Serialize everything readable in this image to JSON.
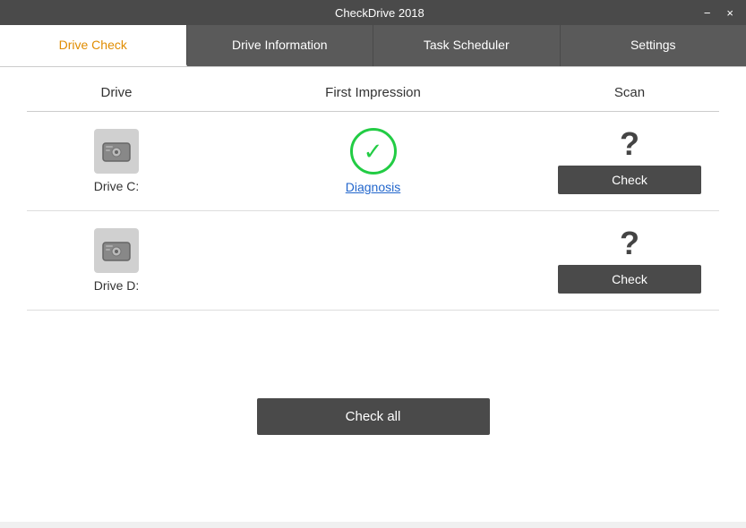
{
  "app": {
    "title": "CheckDrive 2018"
  },
  "titlebar": {
    "minimize_label": "−",
    "close_label": "×"
  },
  "tabs": [
    {
      "id": "drive-check",
      "label": "Drive Check",
      "active": true
    },
    {
      "id": "drive-information",
      "label": "Drive Information",
      "active": false
    },
    {
      "id": "task-scheduler",
      "label": "Task Scheduler",
      "active": false
    },
    {
      "id": "settings",
      "label": "Settings",
      "active": false
    }
  ],
  "table": {
    "col_drive": "Drive",
    "col_impression": "First Impression",
    "col_scan": "Scan"
  },
  "drives": [
    {
      "id": "drive-c",
      "label": "Drive C:",
      "impression_icon": "✓",
      "impression_text": "Diagnosis",
      "scan_symbol": "?",
      "check_label": "Check"
    },
    {
      "id": "drive-d",
      "label": "Drive D:",
      "impression_icon": "",
      "impression_text": "",
      "scan_symbol": "?",
      "check_label": "Check"
    }
  ],
  "footer": {
    "check_all_label": "Check all"
  }
}
